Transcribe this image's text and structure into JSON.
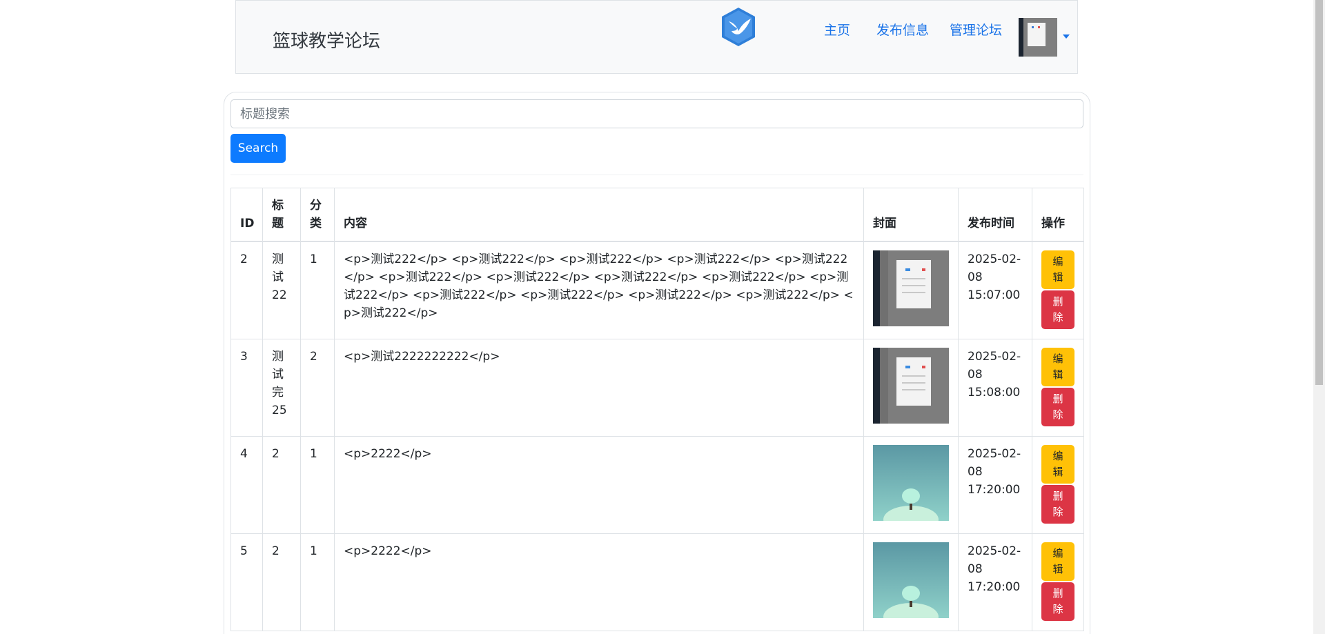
{
  "navbar": {
    "brand": "篮球教学论坛",
    "links": [
      {
        "label": "主页"
      },
      {
        "label": "发布信息"
      },
      {
        "label": "管理论坛"
      }
    ]
  },
  "search": {
    "placeholder": "标题搜索",
    "value": "",
    "button_label": "Search"
  },
  "table": {
    "headers": [
      "ID",
      "标题",
      "分类",
      "内容",
      "封面",
      "发布时间",
      "操作"
    ],
    "rows": [
      {
        "id": "2",
        "title": "测试22",
        "category": "1",
        "content": "<p>测试222</p> <p>测试222</p> <p>测试222</p> <p>测试222</p> <p>测试222</p> <p>测试222</p> <p>测试222</p> <p>测试222</p> <p>测试222</p> <p>测试222</p> <p>测试222</p> <p>测试222</p> <p>测试222</p> <p>测试222</p> <p>测试222</p>",
        "cover": "screenshot",
        "time": "2025-02-08 15:07:00",
        "edit_label": "编辑",
        "delete_label": "删除"
      },
      {
        "id": "3",
        "title": "测试完25",
        "category": "2",
        "content": "<p>测试2222222222</p>",
        "cover": "screenshot",
        "time": "2025-02-08 15:08:00",
        "edit_label": "编辑",
        "delete_label": "删除"
      },
      {
        "id": "4",
        "title": "2",
        "category": "1",
        "content": "<p>2222</p>",
        "cover": "tree",
        "time": "2025-02-08 17:20:00",
        "edit_label": "编辑",
        "delete_label": "删除"
      },
      {
        "id": "5",
        "title": "2",
        "category": "1",
        "content": "<p>2222</p>",
        "cover": "tree",
        "time": "2025-02-08 17:20:00",
        "edit_label": "编辑",
        "delete_label": "删除"
      }
    ]
  },
  "colors": {
    "primary": "#0d7bff",
    "warning": "#ffc107",
    "danger": "#dc3545",
    "link": "#1a73e8"
  },
  "icons": {
    "logo": "bird-hexagon-icon",
    "caret": "caret-down-icon"
  }
}
